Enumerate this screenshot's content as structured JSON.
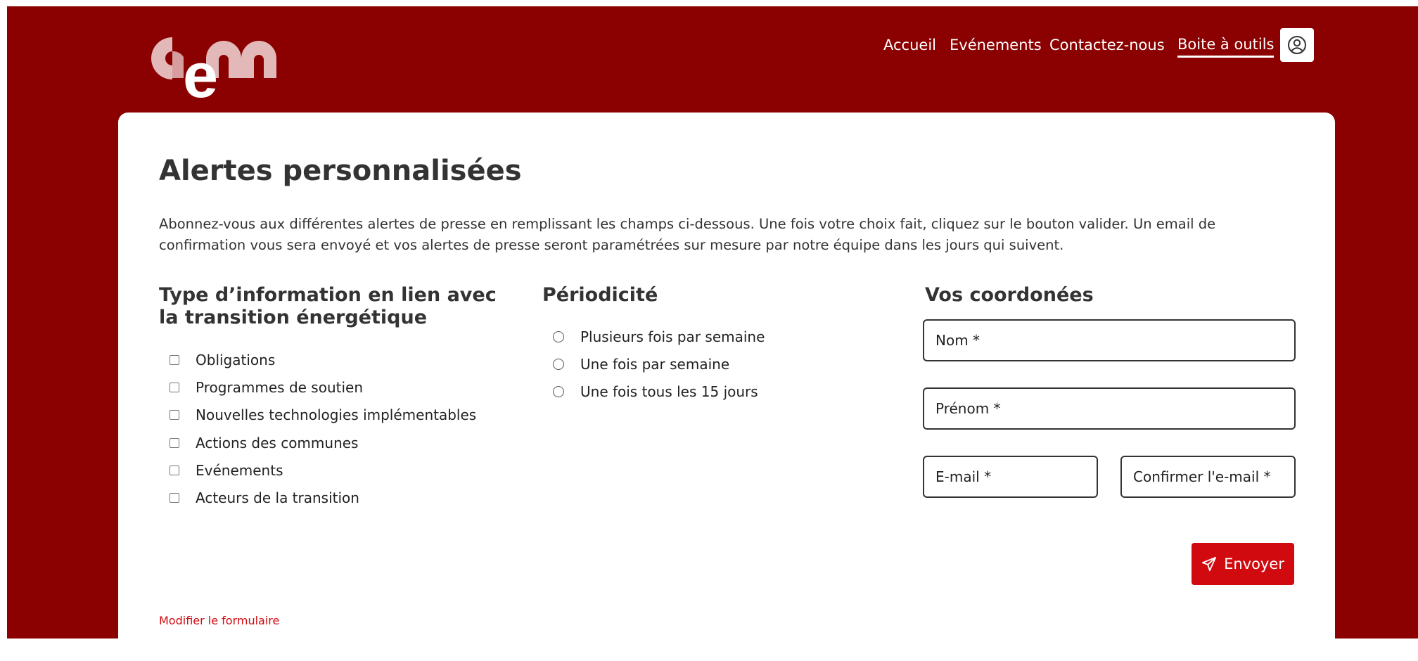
{
  "nav": {
    "items": [
      {
        "label": "Accueil",
        "active": false
      },
      {
        "label": "Evénements",
        "active": false
      },
      {
        "label": "Contactez-nous",
        "active": false
      },
      {
        "label": "Boite à outils",
        "active": true
      }
    ],
    "user_icon": "user-circle-icon"
  },
  "logo": {
    "text": "cem"
  },
  "page": {
    "title": "Alertes personnalisées",
    "intro": "Abonnez-vous aux différentes alertes de presse en remplissant les champs ci-dessous. Une fois votre choix fait, cliquez sur le bouton valider. Un email de confirmation vous sera envoyé et vos alertes de presse seront paramétrées sur mesure par notre équipe dans les jours qui suivent."
  },
  "info_types": {
    "title": "Type d’information en lien avec la transition énergétique",
    "options": [
      {
        "label": "Obligations",
        "checked": false
      },
      {
        "label": "Programmes de soutien",
        "checked": false
      },
      {
        "label": "Nouvelles technologies implémentables",
        "checked": false
      },
      {
        "label": "Actions des communes",
        "checked": false
      },
      {
        "label": "Evénements",
        "checked": false
      },
      {
        "label": "Acteurs de la transition",
        "checked": false
      }
    ]
  },
  "periodicity": {
    "title": "Périodicité",
    "options": [
      {
        "label": "Plusieurs fois par semaine",
        "selected": false
      },
      {
        "label": "Une fois par semaine",
        "selected": false
      },
      {
        "label": "Une fois tous les 15 jours",
        "selected": false
      }
    ]
  },
  "contact": {
    "title": "Vos coordonées",
    "nom_placeholder": "Nom *",
    "prenom_placeholder": "Prénom *",
    "email_placeholder": "E-mail *",
    "confirm_email_placeholder": "Confirmer l'e-mail *",
    "submit_label": "Envoyer",
    "submit_icon": "paper-plane-icon"
  },
  "footer": {
    "modify_link": "Modifier le formulaire"
  },
  "colors": {
    "brand_dark_red": "#8b0000",
    "button_red": "#d10a10",
    "text_dark": "#333333"
  }
}
